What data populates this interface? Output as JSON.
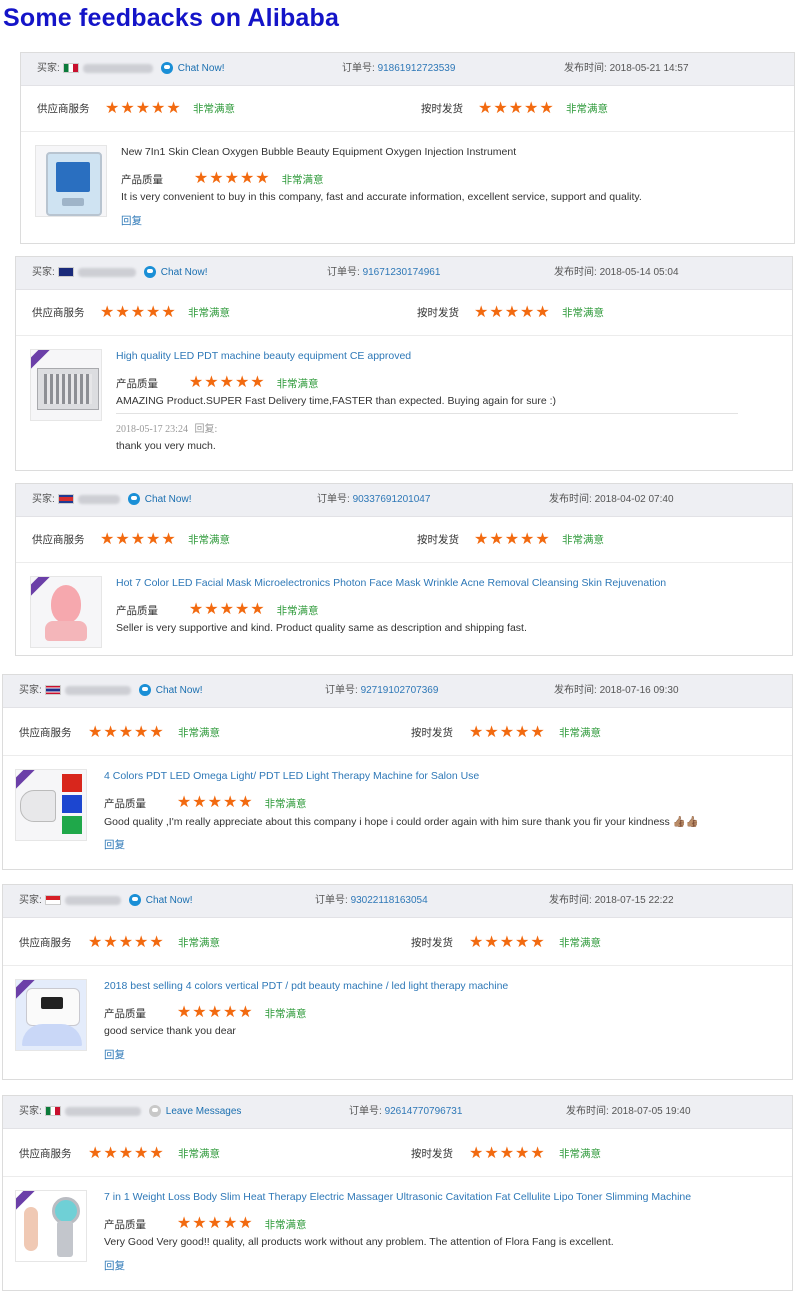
{
  "page_title": "Some feedbacks on Alibaba",
  "labels": {
    "buyer": "买家:",
    "order_no": "订单号:",
    "published": "发布时间:",
    "supplier_service": "供应商服务",
    "on_time_shipping": "按时发货",
    "product_quality": "产品质量",
    "very_satisfied": "非常满意",
    "reply": "回复",
    "stars": "★★★★★"
  },
  "reviews": [
    {
      "flag": "mexico-flag",
      "contact": "Chat Now!",
      "order_number": "91861912723539",
      "date": "2018-05-21 14:57",
      "product_title": "New 7In1 Skin Clean Oxygen Bubble Beauty Equipment Oxygen Injection Instrument",
      "comment": "It is very convenient to buy in this company, fast and accurate information, excellent service, support and quality.",
      "thumbnail": "oxygen-device-image"
    },
    {
      "flag": "australia-flag",
      "contact": "Chat Now!",
      "order_number": "91671230174961",
      "date": "2018-05-14 05:04",
      "product_title": "High quality LED PDT machine beauty equipment CE approved",
      "comment": "AMAZING Product.SUPER Fast Delivery time,FASTER than expected. Buying again for sure :)",
      "reply_date": "2018-05-17 23:24",
      "reply_label": "回复:",
      "reply_text": "thank you very much.",
      "thumbnail": "led-pdt-machine-image"
    },
    {
      "flag": "cambodia-flag",
      "contact": "Chat Now!",
      "order_number": "90337691201047",
      "date": "2018-04-02 07:40",
      "product_title": "Hot 7 Color LED Facial Mask Microelectronics Photon Face Mask Wrinkle Acne Removal Cleansing Skin Rejuvenation",
      "comment": "Seller is very supportive and kind. Product quality same as description and shipping fast.",
      "thumbnail": "led-face-mask-image"
    },
    {
      "flag": "thailand-flag",
      "contact": "Chat Now!",
      "order_number": "92719102707369",
      "date": "2018-07-16 09:30",
      "product_title": "4 Colors PDT LED Omega Light/ PDT LED Light Therapy Machine for Salon Use",
      "comment": "Good quality ,I'm really appreciate about this company i hope i could order again with him sure thank you fir your kindness 👍🏽👍🏽",
      "thumbnail": "omega-light-image"
    },
    {
      "flag": "indonesia-flag",
      "contact": "Chat Now!",
      "order_number": "93022118163054",
      "date": "2018-07-15 22:22",
      "product_title": "2018 best selling 4 colors vertical PDT / pdt beauty machine / led light therapy machine",
      "comment": "good service thank you dear",
      "thumbnail": "vertical-pdt-image"
    },
    {
      "flag": "mexico-flag",
      "contact": "Leave Messages",
      "order_number": "92614770796731",
      "date": "2018-07-05 19:40",
      "product_title": "7 in 1 Weight Loss Body Slim Heat Therapy Electric Massager Ultrasonic Cavitation Fat Cellulite Lipo Toner Slimming Machine",
      "comment": "Very Good Very good!! quality, all products work without any problem. The attention of Flora Fang is excellent.",
      "thumbnail": "slimming-machine-image"
    }
  ]
}
